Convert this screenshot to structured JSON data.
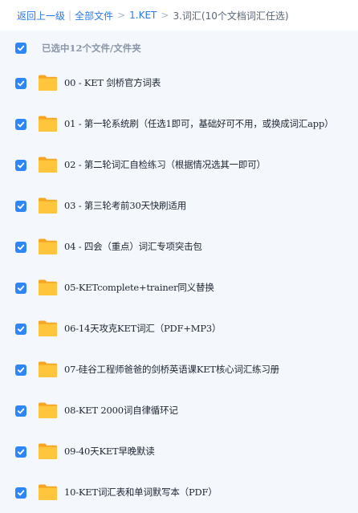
{
  "breadcrumb": {
    "back": "返回上一级",
    "all_files": "全部文件",
    "level1": "1.KET",
    "current": "3.词汇(10个文档词汇任选)"
  },
  "selection": {
    "summary": "已选中12个文件/文件夹",
    "all_checked": true
  },
  "files": [
    {
      "name": "00 - KET 剑桥官方词表",
      "checked": true,
      "icon": "folder-icon"
    },
    {
      "name": "01 - 第一轮系统刷（任选1即可，基础好可不用，或换成词汇app）",
      "checked": true,
      "icon": "folder-icon"
    },
    {
      "name": "02 - 第二轮词汇自检练习（根据情况选其一即可）",
      "checked": true,
      "icon": "folder-icon"
    },
    {
      "name": "03 - 第三轮考前30天快刷适用",
      "checked": true,
      "icon": "folder-icon"
    },
    {
      "name": "04 - 四会（重点）词汇专项突击包",
      "checked": true,
      "icon": "folder-icon"
    },
    {
      "name": "05-KETcomplete+trainer同义替换",
      "checked": true,
      "icon": "folder-icon"
    },
    {
      "name": "06-14天攻克KET词汇（PDF+MP3）",
      "checked": true,
      "icon": "folder-icon"
    },
    {
      "name": "07-硅谷工程师爸爸的剑桥英语课KET核心词汇练习册",
      "checked": true,
      "icon": "folder-icon"
    },
    {
      "name": "08-KET 2000词自律循环记",
      "checked": true,
      "icon": "folder-icon"
    },
    {
      "name": "09-40天KET早晚默读",
      "checked": true,
      "icon": "folder-icon"
    },
    {
      "name": "10-KET词汇表和单词默写本（PDF）",
      "checked": true,
      "icon": "folder-icon"
    }
  ],
  "colors": {
    "accent": "#2f86f5",
    "link": "#2b7ae6",
    "folder": "#ffc53d",
    "folder_back": "#f6a623",
    "background": "#f4f8fd"
  }
}
